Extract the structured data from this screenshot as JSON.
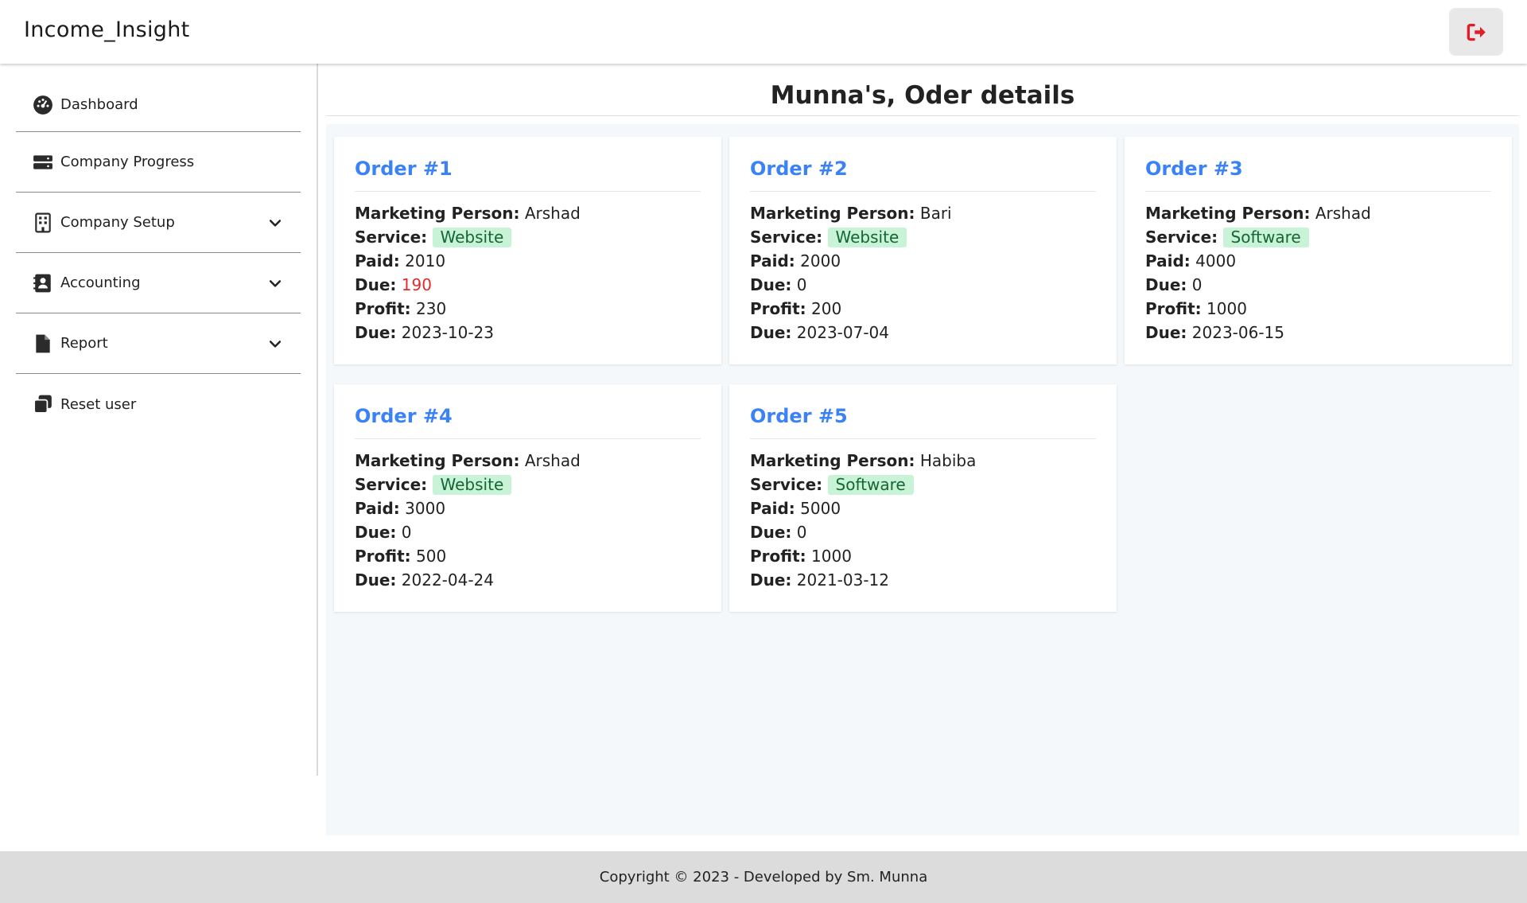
{
  "header": {
    "brand": "Income_Insight"
  },
  "sidebar": {
    "items": [
      {
        "label": "Dashboard",
        "icon": "dashboard-icon"
      },
      {
        "label": "Company Progress",
        "icon": "server-icon"
      },
      {
        "label": "Company Setup",
        "icon": "building-icon",
        "expandable": true
      },
      {
        "label": "Accounting",
        "icon": "contact-card-icon",
        "expandable": true
      },
      {
        "label": "Report",
        "icon": "file-icon",
        "expandable": true
      },
      {
        "label": "Reset user",
        "icon": "copy-icon"
      }
    ]
  },
  "main": {
    "title": "Munna's, Oder details",
    "labels": {
      "marketing": "Marketing Person:",
      "service": "Service:",
      "paid": "Paid:",
      "due": "Due:",
      "profit": "Profit:",
      "due_date": "Due:"
    },
    "orders": [
      {
        "title": "Order #1",
        "marketing_person": "Arshad",
        "service": "Website",
        "paid": "2010",
        "due": "190",
        "profit": "230",
        "due_date": "2023-10-23"
      },
      {
        "title": "Order #2",
        "marketing_person": "Bari",
        "service": "Website",
        "paid": "2000",
        "due": "0",
        "profit": "200",
        "due_date": "2023-07-04"
      },
      {
        "title": "Order #3",
        "marketing_person": "Arshad",
        "service": "Software",
        "paid": "4000",
        "due": "0",
        "profit": "1000",
        "due_date": "2023-06-15"
      },
      {
        "title": "Order #4",
        "marketing_person": "Arshad",
        "service": "Website",
        "paid": "3000",
        "due": "0",
        "profit": "500",
        "due_date": "2022-04-24"
      },
      {
        "title": "Order #5",
        "marketing_person": "Habiba",
        "service": "Software",
        "paid": "5000",
        "due": "0",
        "profit": "1000",
        "due_date": "2021-03-12"
      }
    ]
  },
  "footer": {
    "text": "Copyright © 2023 - Developed by Sm. Munna"
  },
  "colors": {
    "accent": "#3b82f6",
    "due_alert": "#e12b2b",
    "badge_bg": "#c8f3d6",
    "logout": "#e11d2a"
  }
}
